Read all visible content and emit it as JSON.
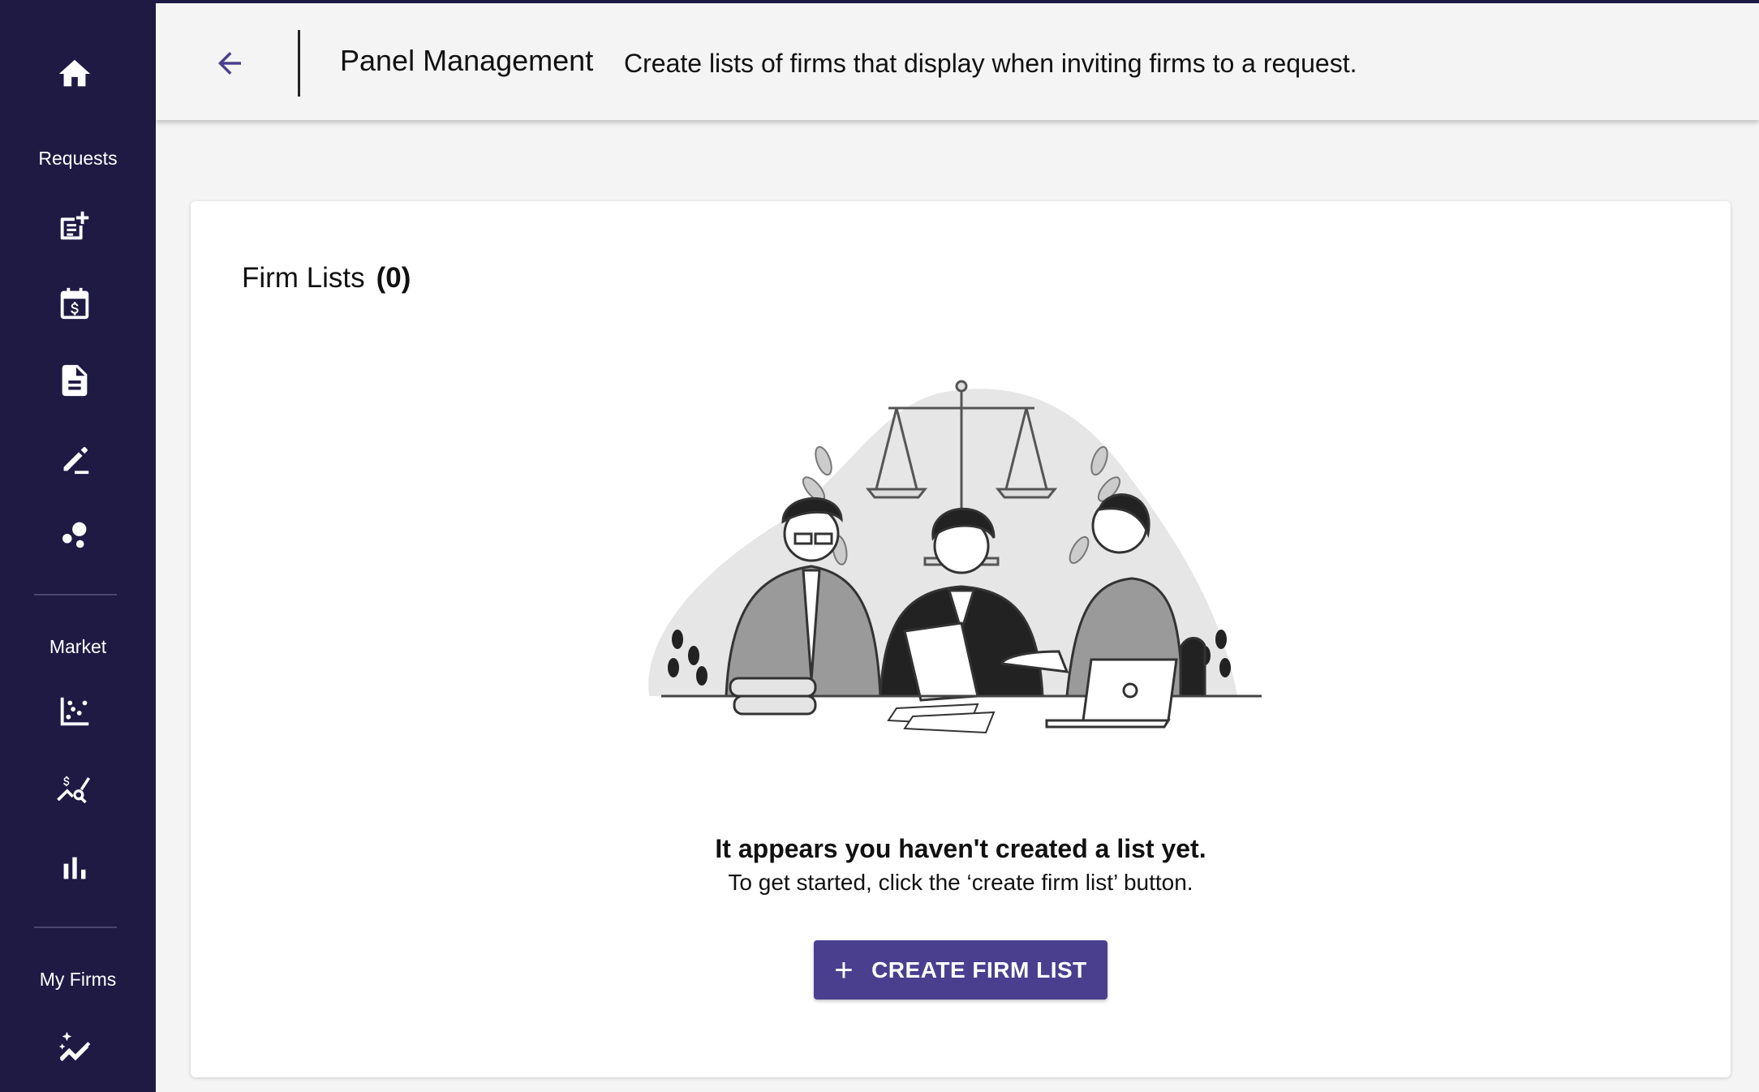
{
  "sidebar": {
    "sections": [
      {
        "label": "Requests"
      },
      {
        "label": "Market"
      },
      {
        "label": "My Firms"
      }
    ],
    "icons": {
      "home": "home-icon",
      "new_request": "new-request-icon",
      "billing_calendar": "billing-calendar-icon",
      "document": "document-icon",
      "edit": "edit-icon",
      "bubbles": "bubbles-icon",
      "scatter_chart": "scatter-chart-icon",
      "price_search": "price-search-icon",
      "bar_chart": "bar-chart-icon",
      "sparkle_trend": "sparkle-trend-icon"
    }
  },
  "header": {
    "title": "Panel Management",
    "subtitle": "Create lists of firms that display when inviting firms to a request."
  },
  "card": {
    "title": "Firm Lists",
    "count": "(0)",
    "empty_heading": "It appears you haven't created a list yet.",
    "empty_sub": "To get started, click the ‘create firm list’ button.",
    "button_label": "CREATE FIRM LIST"
  },
  "colors": {
    "sidebar_bg": "#1e1a44",
    "accent": "#4a3f8f",
    "page_bg": "#f4f4f4"
  }
}
